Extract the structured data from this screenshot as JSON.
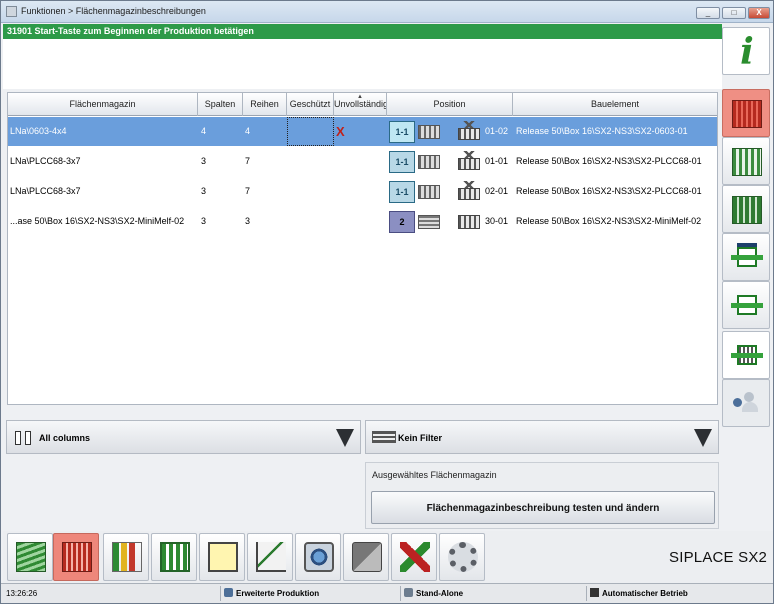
{
  "window": {
    "title": "Funktionen > Flächenmagazinbeschreibungen",
    "minimize": "_",
    "maximize": "□",
    "close": "X"
  },
  "message": "31901 Start-Taste zum Beginnen der Produktion betätigen",
  "table": {
    "columns": [
      "Flächenmagazin",
      "Spalten",
      "Reihen",
      "Geschützt",
      "Unvollständig",
      "Position",
      "Bauelement"
    ],
    "sort_indicator": "▲",
    "rows": [
      {
        "magazine": "LNa\\0603-4x4",
        "cols": "4",
        "rows": "4",
        "protected": "",
        "incomplete": "X",
        "pos_label": "1-1",
        "pos_code": "01-02",
        "component": "Release 50\\Box 16\\SX2-NS3\\SX2-0603-01",
        "selected": true
      },
      {
        "magazine": "LNa\\PLCC68-3x7",
        "cols": "3",
        "rows": "7",
        "protected": "",
        "incomplete": "",
        "pos_label": "1-1",
        "pos_code": "01-01",
        "component": "Release 50\\Box 16\\SX2-NS3\\SX2-PLCC68-01",
        "selected": false
      },
      {
        "magazine": "LNa\\PLCC68-3x7",
        "cols": "3",
        "rows": "7",
        "protected": "",
        "incomplete": "",
        "pos_label": "1-1",
        "pos_code": "02-01",
        "component": "Release 50\\Box 16\\SX2-NS3\\SX2-PLCC68-01",
        "selected": false
      },
      {
        "magazine": "...ase 50\\Box 16\\SX2-NS3\\SX2-MiniMelf-02",
        "cols": "3",
        "rows": "3",
        "protected": "",
        "incomplete": "",
        "pos_label": "2",
        "pos_code": "30-01",
        "component": "Release 50\\Box 16\\SX2-NS3\\SX2-MiniMelf-02",
        "selected": false
      }
    ]
  },
  "columns_filter": {
    "label": "All columns"
  },
  "row_filter": {
    "label": "Kein Filter"
  },
  "selected_panel": {
    "caption": "Ausgewähltes Flächenmagazin",
    "button": "Flächenmagazinbeschreibung testen und ändern"
  },
  "sidebar": {
    "icons": [
      "info-icon",
      "tray-icon",
      "tray-list-icon",
      "tray-grid-icon",
      "feeder-icon",
      "feeder-icon-2",
      "placement-icon",
      "users-icon"
    ],
    "info_glyph": "i"
  },
  "toolbar": {
    "icons": [
      "boards-icon",
      "tray-icon",
      "bar-chart-icon",
      "board-icon",
      "warning-docs-icon",
      "line-chart-icon",
      "camera-icon",
      "oil-can-icon",
      "tools-icon",
      "hand-gear-icon"
    ],
    "brand": "SIPLACE SX2"
  },
  "status": {
    "time": "13:26:26",
    "mode": "Erweiterte Produktion",
    "connection": "Stand-Alone",
    "operation": "Automatischer Betrieb"
  }
}
